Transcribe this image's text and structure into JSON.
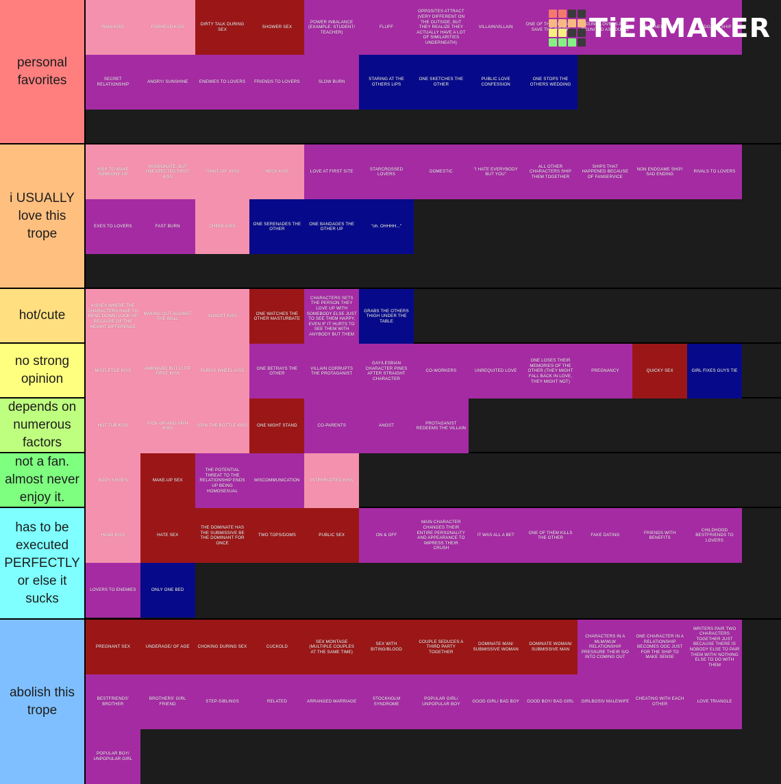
{
  "app": {
    "logo_text": "TiERMAKER",
    "logo_squares": [
      "#f4796d",
      "#f4796d",
      "#3a3a3a",
      "#3a3a3a",
      "#f7b982",
      "#f7b982",
      "#f7b982",
      "#f7b982",
      "#f7f07e",
      "#f7f07e",
      "#3a3a3a",
      "#3a3a3a",
      "#84f283",
      "#84f283",
      "#84f283",
      "#3a3a3a"
    ]
  },
  "palette": {
    "pink": "#f491ae",
    "dark_red": "#9b1717",
    "purple": "#a52ba3",
    "navy": "#060a8a",
    "background": "#1c1c1c",
    "tier_1": "#ff7f7f",
    "tier_2": "#ffbf7f",
    "tier_3": "#ffdf80",
    "tier_4": "#ffff7f",
    "tier_5": "#bfff7f",
    "tier_6": "#7eff80",
    "tier_7": "#7fffff",
    "tier_8": "#7fbfff"
  },
  "tiers": [
    {
      "label": "personal favorites",
      "color": "#ff7f7f",
      "items": [
        {
          "text": "RAIN KISS",
          "color": "pink"
        },
        {
          "text": "FORHEAD KISS",
          "color": "pink"
        },
        {
          "text": "DIRTY TALK DURING SEX",
          "color": "darkred"
        },
        {
          "text": "SHOWER SEX",
          "color": "darkred"
        },
        {
          "text": "POWER INBALANCE (EXAMPLE: STUDENT/ TEACHER)",
          "color": "purple"
        },
        {
          "text": "FLUFF",
          "color": "purple"
        },
        {
          "text": "OPPOSITES ATTRACT (VERY DIFFERENT ON THE OUTSIDE, BUT THEY REALIZE THEY ACTUALLY HAVE A LOT OF SIMILARITIES UNDERNEATH)",
          "color": "purple"
        },
        {
          "text": "VILLAIN/VILLAIN",
          "color": "purple"
        },
        {
          "text": "ONE OF THEM DIES TO SAVE THE OTHER",
          "color": "purple"
        },
        {
          "text": "YOUNG LOVERS ARE REUNITED AS ADULTS",
          "color": "purple"
        },
        {
          "text": "DESTINED TO BE",
          "color": "purple"
        },
        {
          "text": "ENDGAME SHIP",
          "color": "purple"
        },
        {
          "text": "SECRET RELATIONSHIP",
          "color": "purple"
        },
        {
          "text": "ANGRY/ SUNSHINE",
          "color": "purple"
        },
        {
          "text": "ENEMIES TO LOVERS",
          "color": "purple"
        },
        {
          "text": "FRIENDS TO LOVERS",
          "color": "purple"
        },
        {
          "text": "SLOW BURN",
          "color": "purple"
        },
        {
          "text": "STARING AT THE OTHERS LIPS",
          "color": "navy"
        },
        {
          "text": "ONE SKETCHES THE OTHER",
          "color": "navy"
        },
        {
          "text": "PUBLIC LOVE CONFESSION",
          "color": "navy"
        },
        {
          "text": "ONE STOPS THE OTHERS WEDDING",
          "color": "navy"
        }
      ]
    },
    {
      "label": "i USUALLY love this trope",
      "color": "#ffbf7f",
      "items": [
        {
          "text": "KISS TO WAKE SOMEONE UP",
          "color": "pink"
        },
        {
          "text": "PASSIONATE, BUT UNEXPECTED FIRST KISS",
          "color": "pink"
        },
        {
          "text": "\"SHUT-UP\" KISS",
          "color": "pink"
        },
        {
          "text": "NECK KISS",
          "color": "pink"
        },
        {
          "text": "LOVE AT FIRST SITE",
          "color": "purple"
        },
        {
          "text": "STARCROSSED LOVERS",
          "color": "purple"
        },
        {
          "text": "DOMESTIC",
          "color": "purple"
        },
        {
          "text": "\"I HATE EVERYBODY BUT YOU\"",
          "color": "purple"
        },
        {
          "text": "ALL OTHER CHARACTERS SHIP THEM TOGETHER",
          "color": "purple"
        },
        {
          "text": "SHIPS THAT HAPPENED BECAUSE OF FANSERVICE",
          "color": "purple"
        },
        {
          "text": "NON ENDGAME SHIP/ SAD ENDING",
          "color": "purple"
        },
        {
          "text": "RIVALS TO LOVERS",
          "color": "purple"
        },
        {
          "text": "EXES TO LOVERS",
          "color": "purple"
        },
        {
          "text": "FAST BURN",
          "color": "purple"
        },
        {
          "text": "CHEEK KISS",
          "color": "pink"
        },
        {
          "text": "ONE SERENADES THE OTHER",
          "color": "navy"
        },
        {
          "text": "ONE BANDAGES THE OTHER UP",
          "color": "navy"
        },
        {
          "text": "\"oh. OHHHH...\"",
          "color": "navy"
        }
      ]
    },
    {
      "label": "hot/cute",
      "color": "#ffdf80",
      "items": [
        {
          "text": "KISSES WHERE THE CHARACTERS HAVE TO BEND DOWN/ LOOK UP BECAUSE OF THE HEIGHT DIFFERENCE",
          "color": "pink"
        },
        {
          "text": "MAKING OUT AGAINST THE WALL",
          "color": "pink"
        },
        {
          "text": "ALMOST KISS",
          "color": "pink"
        },
        {
          "text": "ONE WATCHES THE OTHER MASTURBATE",
          "color": "darkred"
        },
        {
          "text": "CHARACTERS SETS THE PERSON THEY LOVE UP WITH SOMEBODY ELSE JUST TO SEE THEM HAPPY, EVEN IF IT HURTS TO SEE THEM WITH ANYBODY BUT THEM",
          "color": "purple"
        },
        {
          "text": "GRABS THE OTHERS THIGH UNDER THE TABLE",
          "color": "navy"
        }
      ]
    },
    {
      "label": "no strong opinion",
      "color": "#ffff7f",
      "items": [
        {
          "text": "MISTLETOE KISS",
          "color": "pink"
        },
        {
          "text": "AWKWARD BUT CUTE FIRST KISS",
          "color": "pink"
        },
        {
          "text": "FARRIS WHEEL KISS",
          "color": "pink"
        },
        {
          "text": "ONE BETRAYS THE OTHER",
          "color": "purple"
        },
        {
          "text": "VILLAIN CORRUPTS THE PROTAGANIST",
          "color": "purple"
        },
        {
          "text": "GAY/LESBIAN CHARACTER PINES AFTER STRAIGHT CHARACTER",
          "color": "purple"
        },
        {
          "text": "CO-WORKERS",
          "color": "purple"
        },
        {
          "text": "UNREQUITED LOVE",
          "color": "purple"
        },
        {
          "text": "ONE LOSES THEIR MEMORIES OF THE OTHER (THEY MIGHT FALL BACK IN LOVE, THEY MIGHT NOT)",
          "color": "purple"
        },
        {
          "text": "PREGNANCY",
          "color": "purple"
        },
        {
          "text": "QUICKY SEX",
          "color": "darkred"
        },
        {
          "text": "GIRL FIXES GUYS TIE",
          "color": "navy"
        }
      ]
    },
    {
      "label": "depends on numerous factors",
      "color": "#bfff7f",
      "items": [
        {
          "text": "HOT TUB KISS",
          "color": "pink"
        },
        {
          "text": "PICK-UP-AND-SPIN KISS",
          "color": "pink"
        },
        {
          "text": "SPIN THE BOTTLE KISS",
          "color": "pink"
        },
        {
          "text": "ONE NIGHT STAND",
          "color": "darkred"
        },
        {
          "text": "CO-PARENTS",
          "color": "purple"
        },
        {
          "text": "ANGST",
          "color": "purple"
        },
        {
          "text": "PROTAGANIST REDEEMS THE VILLAIN",
          "color": "purple"
        }
      ]
    },
    {
      "label": "not a fan. almost never enjoy it.",
      "color": "#7eff80",
      "items": [
        {
          "text": "BODY KISSES",
          "color": "pink"
        },
        {
          "text": "MAKE-UP SEX",
          "color": "darkred"
        },
        {
          "text": "THE POTENTIAL THREAT TO THE RELATIONSHIP ENDS UP BEING HOMOSEXUAL",
          "color": "purple"
        },
        {
          "text": "MISCOMMUNICATION",
          "color": "purple"
        },
        {
          "text": "INTERRUPTED KISS",
          "color": "pink"
        }
      ]
    },
    {
      "label": "has to be executed PERFECTLY or else it sucks",
      "color": "#7fffff",
      "items": [
        {
          "text": "HAND KISS",
          "color": "pink"
        },
        {
          "text": "HATE SEX",
          "color": "darkred"
        },
        {
          "text": "THE DOMINATE HAS THE SUBMISSIVE BE THE DOMINANT FOR ONCE",
          "color": "darkred"
        },
        {
          "text": "TWO TOPS/DOMS",
          "color": "darkred"
        },
        {
          "text": "PUBLIC SEX",
          "color": "darkred"
        },
        {
          "text": "ON & OFF",
          "color": "purple"
        },
        {
          "text": "MAIN CHARACTER CHANGES THEIR ENTIRE PERSONALITY AND APPEARANCE TO IMPRESS THEIR CRUSH",
          "color": "purple"
        },
        {
          "text": "IT WAS ALL A BET",
          "color": "purple"
        },
        {
          "text": "ONE OF THEM KILLS THE OTHER",
          "color": "purple"
        },
        {
          "text": "FAKE DATING",
          "color": "purple"
        },
        {
          "text": "FRIENDS WITH BENEFITS",
          "color": "purple"
        },
        {
          "text": "CHILDHOOD BESTFRIENDS TO LOVERS",
          "color": "purple"
        },
        {
          "text": "LOVERS TO ENEMIES",
          "color": "purple"
        },
        {
          "text": "ONLY ONE BED",
          "color": "navy"
        }
      ]
    },
    {
      "label": "abolish this trope",
      "color": "#7fbfff",
      "items": [
        {
          "text": "PREGNANT SEX",
          "color": "darkred"
        },
        {
          "text": "UNDERAGE/ OF AGE",
          "color": "darkred"
        },
        {
          "text": "CHOKING DURING SEX",
          "color": "darkred"
        },
        {
          "text": "CUCKOLD",
          "color": "darkred"
        },
        {
          "text": "SEX MONTAGE (MULTIPLE COUPLES AT THE SAME TIME)",
          "color": "darkred"
        },
        {
          "text": "SEX WITH BITING/BLOOD",
          "color": "darkred"
        },
        {
          "text": "COUPLE SEDUCES A THIRD PARTY TOGETHER",
          "color": "darkred"
        },
        {
          "text": "DOMINATE MAN/ SUBMISSIVE WOMAN",
          "color": "darkred"
        },
        {
          "text": "DOMINATE WOMAN/ SUBMISSIVE MAN",
          "color": "darkred"
        },
        {
          "text": "CHARACTERS IN A MLM/WLW RELATIONSHIP PRESSURE THEIR S/O INTO COMING OUT",
          "color": "purple"
        },
        {
          "text": "ONE CHARACTER IN A RELATIONSHIP BECOMES OOC JUST FOR THE SHIP TO MAKE SENSE",
          "color": "purple"
        },
        {
          "text": "WRITERS PAIR TWO CHARACTERS TOGETHER JUST BECAUSE THERE IS NOBODY ELSE TO PAIR THEM WITH/ NOTHING ELSE TO DO WITH THEM",
          "color": "purple"
        },
        {
          "text": "BESTFRIENDS' BROTHER",
          "color": "purple"
        },
        {
          "text": "BROTHERS' GIRL FRIEND",
          "color": "purple"
        },
        {
          "text": "STEP-SIBLINGS",
          "color": "purple"
        },
        {
          "text": "RELATED",
          "color": "purple"
        },
        {
          "text": "ARRANGED MARRIAGE",
          "color": "purple"
        },
        {
          "text": "STOCKHOLM SYNDROME",
          "color": "purple"
        },
        {
          "text": "POPULAR GIRL/ UNPOPULAR BOY",
          "color": "purple"
        },
        {
          "text": "GOOD GIRL/ BAD BOY",
          "color": "purple"
        },
        {
          "text": "GOOD BOY/ BAD GIRL",
          "color": "purple"
        },
        {
          "text": "GIRLBOSS/ MALEWIFE",
          "color": "purple"
        },
        {
          "text": "CHEATING WITH EACH OTHER",
          "color": "purple"
        },
        {
          "text": "LOVE TRIANGLE",
          "color": "purple"
        },
        {
          "text": "POPULAR BOY/ UNPOPULAR GIRL",
          "color": "purple"
        }
      ]
    }
  ]
}
